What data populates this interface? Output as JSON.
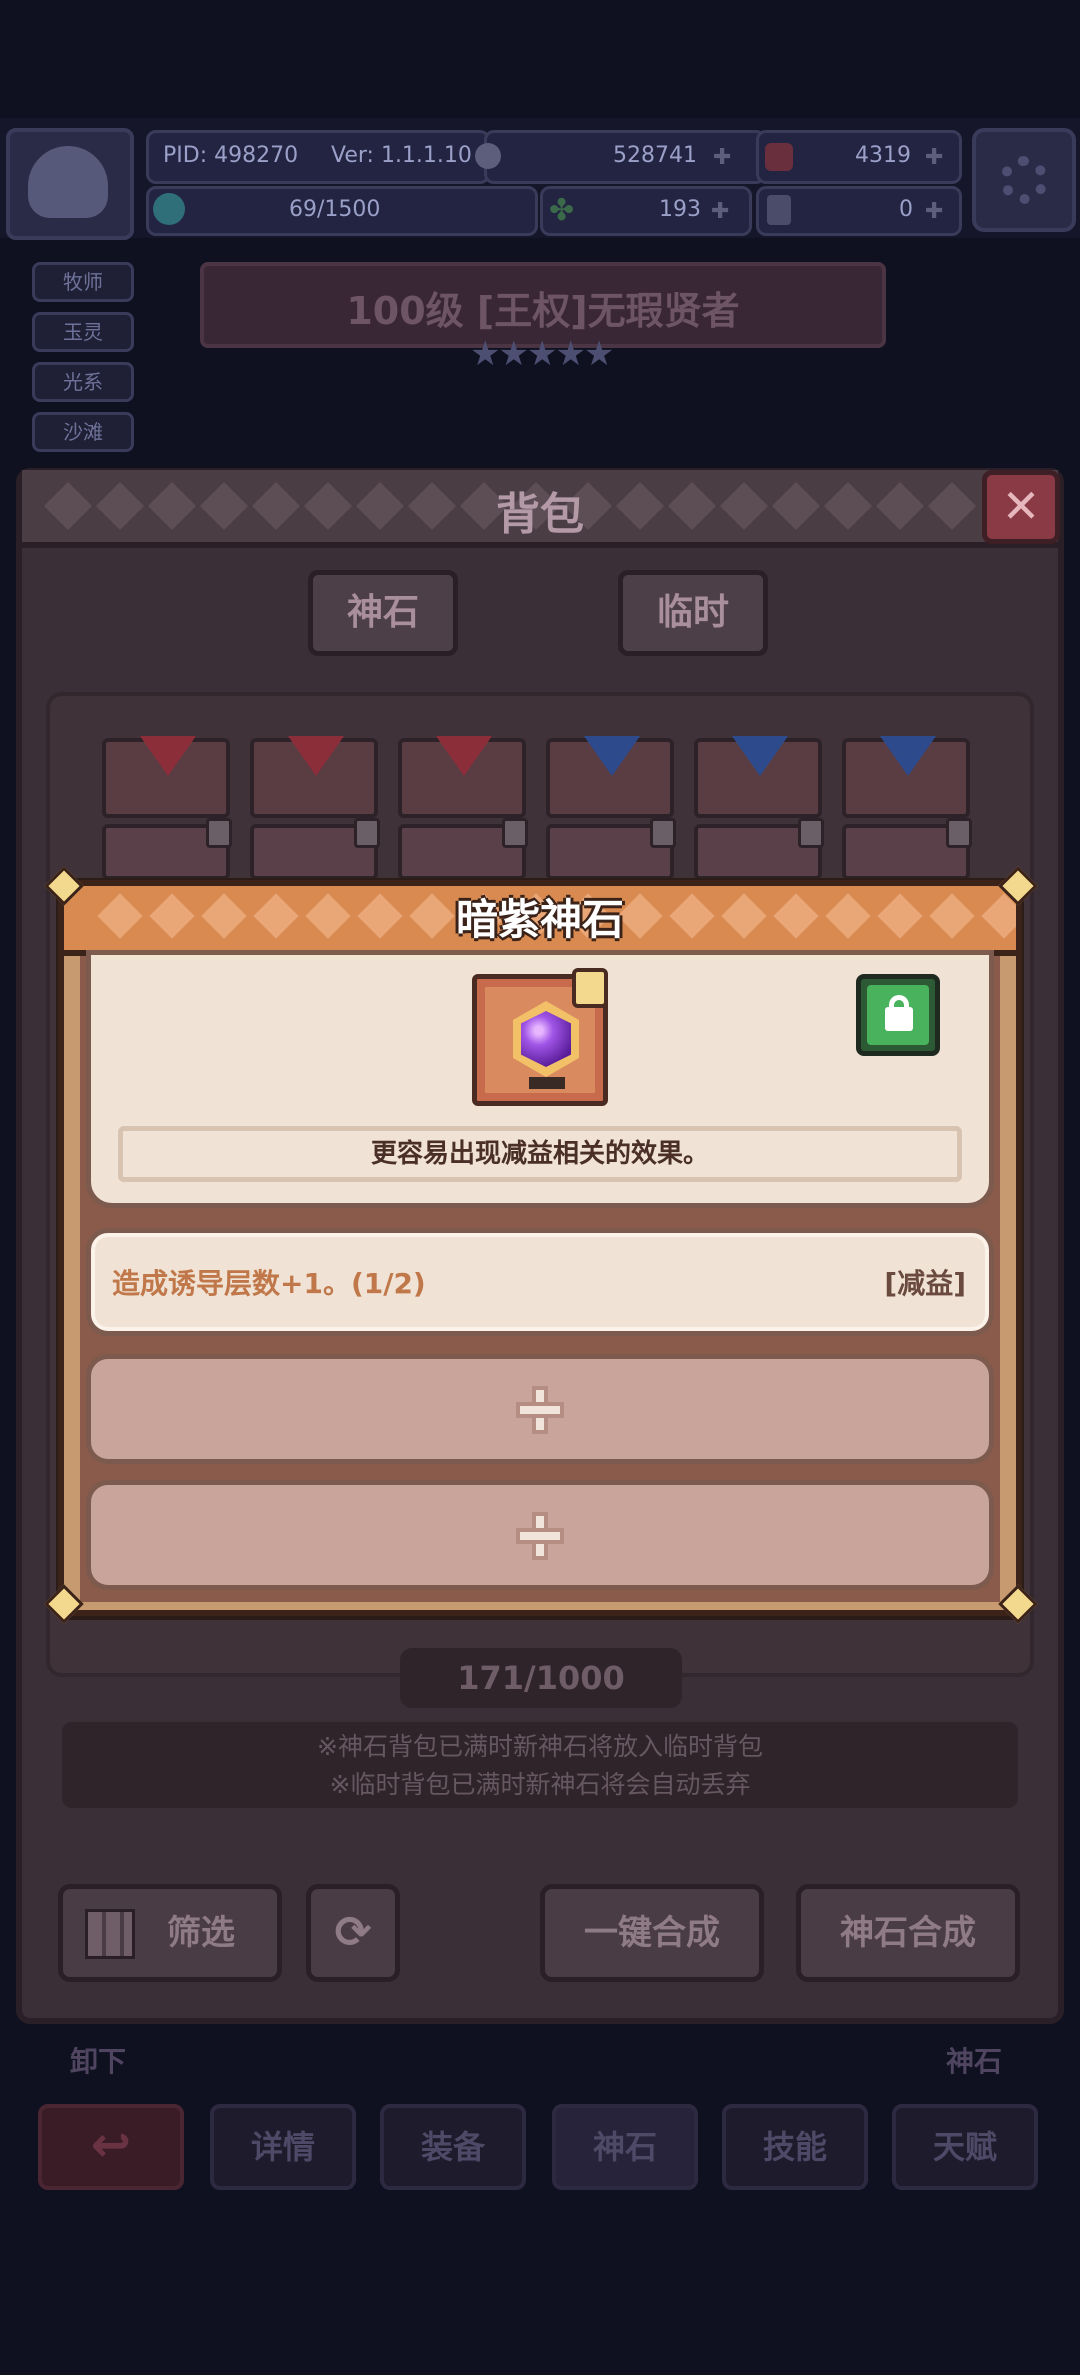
{
  "hud": {
    "pid": "PID: 498270",
    "version": "Ver: 1.1.1.10",
    "gold": "528741",
    "gems": "4319",
    "energy": "69/1500",
    "clover": "193",
    "keys": "0"
  },
  "background": {
    "side_tags": [
      "牧师",
      "玉灵",
      "光系",
      "沙滩"
    ],
    "hero_title": "100级 [王权]无瑕贤者",
    "stars": "★★★★★"
  },
  "bag": {
    "title": "背包",
    "close_glyph": "✕",
    "tabs": [
      "神石",
      "临时"
    ],
    "count": "171/1000",
    "notice_lines": [
      "※神石背包已满时新神石将放入临时背包",
      "※临时背包已满时新神石将会自动丢弃"
    ],
    "buttons": {
      "filter": "筛选",
      "auto_merge": "一键合成",
      "stone_merge": "神石合成"
    },
    "under_labels": [
      "卸下",
      "神石"
    ]
  },
  "bottom_nav": [
    "详情",
    "装备",
    "神石",
    "技能",
    "天赋"
  ],
  "popup": {
    "title": "暗紫神石",
    "gem_color": "#7a2fc9",
    "description": "更容易出现减益相关的效果。",
    "effects": [
      {
        "text": "造成诱导层数+1。(1/2)",
        "tag": "[减益]"
      }
    ],
    "empty_slot_count": 2
  },
  "colors": {
    "popup_header": "#d98a50",
    "popup_frame": "#3b2319",
    "effect_text": "#c0784a",
    "lock_green": "#49b25c"
  }
}
